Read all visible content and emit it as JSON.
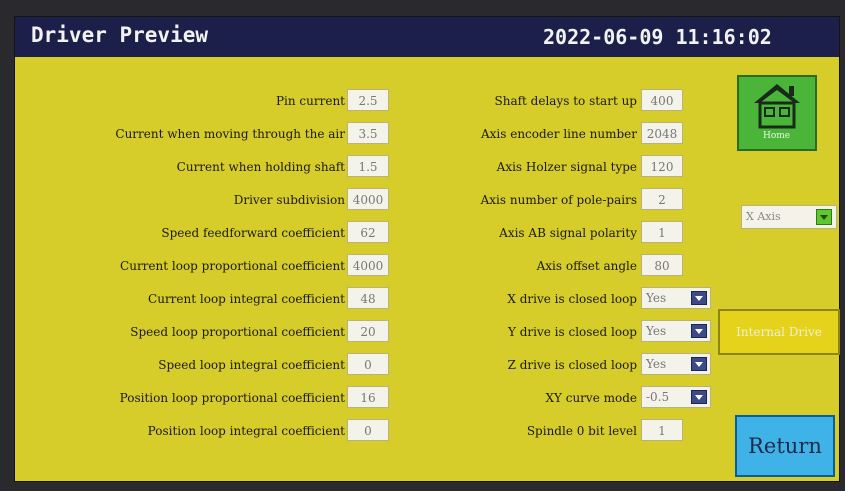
{
  "header": {
    "title": "Driver Preview",
    "datetime": "2022-06-09 11:16:02"
  },
  "left_params": [
    {
      "label": "Pin current",
      "value": "2.5"
    },
    {
      "label": "Current when moving through the air",
      "value": "3.5"
    },
    {
      "label": "Current when  holding shaft",
      "value": "1.5"
    },
    {
      "label": "Driver subdivision",
      "value": "4000"
    },
    {
      "label": "Speed feedforward coefficient",
      "value": "62"
    },
    {
      "label": "Current loop proportional coefficient",
      "value": "4000"
    },
    {
      "label": "Current loop integral coefficient",
      "value": "48"
    },
    {
      "label": "Speed loop proportional coefficient",
      "value": "20"
    },
    {
      "label": "Speed loop integral coefficient",
      "value": "0"
    },
    {
      "label": "Position loop proportional coefficient",
      "value": "16"
    },
    {
      "label": "Position loop integral coefficient",
      "value": "0"
    }
  ],
  "middle_params": [
    {
      "label": "Shaft delays to start up",
      "value": "400"
    },
    {
      "label": "Axis encoder line number",
      "value": "2048"
    },
    {
      "label": "Axis Holzer signal type",
      "value": "120"
    },
    {
      "label": "Axis number of pole-pairs",
      "value": "2"
    },
    {
      "label": "Axis AB signal polarity",
      "value": "1"
    },
    {
      "label": "Axis offset angle",
      "value": "80"
    }
  ],
  "middle_selects": [
    {
      "label": "X drive is closed loop",
      "value": "Yes"
    },
    {
      "label": "Y drive is closed loop",
      "value": "Yes"
    },
    {
      "label": "Z drive is closed loop",
      "value": "Yes"
    },
    {
      "label": "XY curve mode",
      "value": "-0.5"
    }
  ],
  "spindle": {
    "label": "Spindle 0 bit level",
    "value": "1"
  },
  "right": {
    "home_label": "Home",
    "axis_select": "X Axis",
    "internal_drive": "Internal Drive",
    "return_label": "Return"
  },
  "icons": {
    "home": "home-icon",
    "dropdown": "chevron-down-icon"
  },
  "colors": {
    "panel_bg": "#d6cc2a",
    "title_bg": "#1b1f4a",
    "home_btn": "#4bb53a",
    "return_btn": "#3fb3e8",
    "internal_drive_btn": "#e4d31a"
  }
}
